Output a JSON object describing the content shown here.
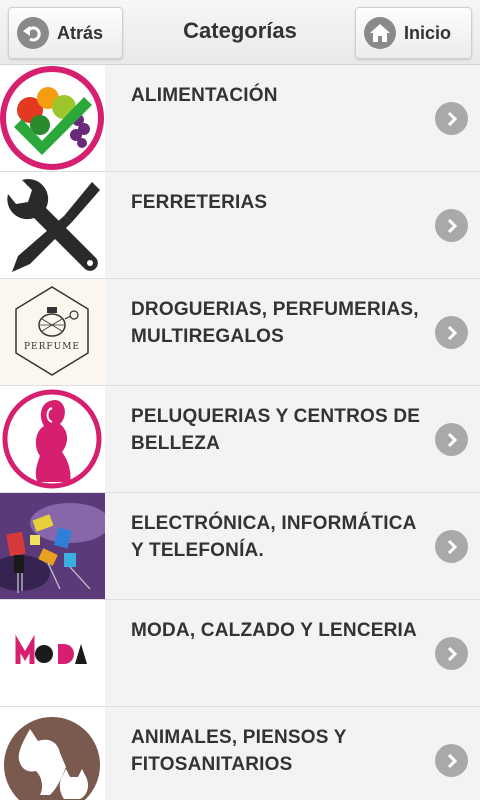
{
  "header": {
    "title": "Categorías",
    "back_label": "Atrás",
    "home_label": "Inicio"
  },
  "categories": [
    {
      "label": "ALIMENTACIÓN",
      "icon": "fruit-basket-icon"
    },
    {
      "label": "FERRETERIAS",
      "icon": "wrench-screwdriver-icon"
    },
    {
      "label": "DROGUERIAS, PERFUMERIAS, MULTIREGALOS",
      "icon": "perfume-shop-icon",
      "icon_text": "PERFUME"
    },
    {
      "label": "PELUQUERIAS Y CENTROS DE BELLEZA",
      "icon": "woman-silhouette-icon"
    },
    {
      "label": "ELECTRÓNICA, INFORMÁTICA Y TELEFONÍA.",
      "icon": "electronic-components-icon"
    },
    {
      "label": "MODA, CALZADO Y LENCERIA",
      "icon": "moda-logo-icon"
    },
    {
      "label": "ANIMALES, PIENSOS Y FITOSANITARIOS",
      "icon": "pets-icon"
    }
  ],
  "colors": {
    "brand_pink": "#d61f6f",
    "button_grey": "#a9a9a9",
    "text": "#333333"
  }
}
